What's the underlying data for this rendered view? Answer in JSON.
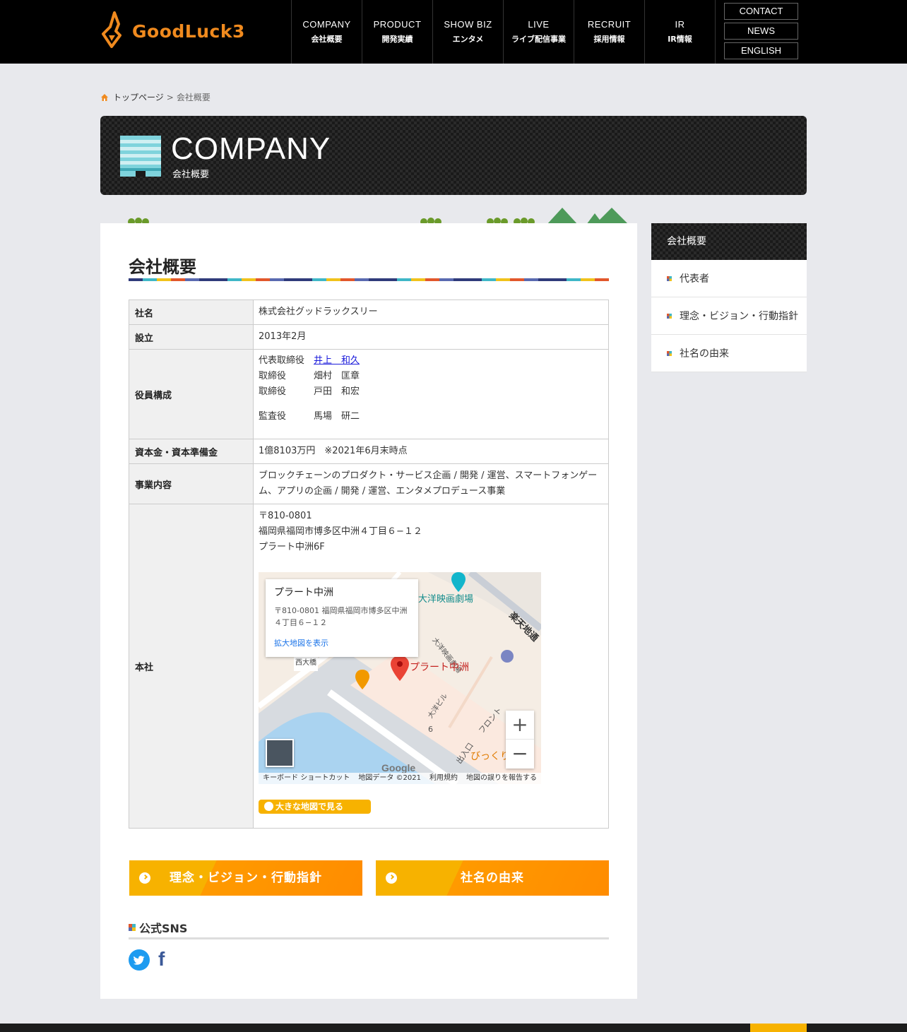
{
  "header": {
    "logo_text": "GoodLuck3",
    "nav": [
      {
        "en": "COMPANY",
        "ja": "会社概要"
      },
      {
        "en": "PRODUCT",
        "ja": "開発実績"
      },
      {
        "en": "SHOW BIZ",
        "ja": "エンタメ"
      },
      {
        "en": "LIVE",
        "ja": "ライブ配信事業"
      },
      {
        "en": "RECRUIT",
        "ja": "採用情報"
      },
      {
        "en": "IR",
        "ja": "IR情報"
      }
    ],
    "side_buttons": [
      "CONTACT",
      "NEWS",
      "ENGLISH"
    ]
  },
  "breadcrumb": {
    "home": "トップページ",
    "separator": ">",
    "current": "会社概要"
  },
  "banner": {
    "title": "COMPANY",
    "subtitle": "会社概要"
  },
  "main": {
    "section_title": "会社概要",
    "table": {
      "name_label": "社名",
      "name_value": "株式会社グッドラックスリー",
      "founded_label": "設立",
      "founded_value": "2013年2月",
      "officers_label": "役員構成",
      "officers": [
        {
          "role": "代表取締役",
          "name": "井上　和久"
        },
        {
          "role": "取締役",
          "name": "畑村　匡章"
        },
        {
          "role": "取締役",
          "name": "戸田　和宏"
        },
        {
          "role": "監査役",
          "name": "馬場　研二"
        }
      ],
      "capital_label": "資本金・資本準備金",
      "capital_value": "1億8103万円　※2021年6月末時点",
      "business_label": "事業内容",
      "business_value": "ブロックチェーンのプロダクト・サービス企画 / 開発 / 運営、スマートフォンゲーム、アプリの企画 / 開発 / 運営、エンタメプロデュース事業",
      "hq_label": "本社",
      "hq_postal": "〒810-0801",
      "hq_address": "福岡県福岡市博多区中洲４丁目６−１２",
      "hq_building": "プラート中洲6F"
    },
    "map": {
      "card_title": "プラート中洲",
      "card_address": "〒810-0801 福岡県福岡市博多区中洲４丁目６−１２",
      "card_link": "拡大地図を表示",
      "labels": {
        "theater": "大洋映画劇場",
        "theater_vertical": "大洋映画劇場",
        "place": "プラート中洲",
        "bridge": "西大橋",
        "street": "楽天地通",
        "building": "大洋ビル",
        "front": "フロント",
        "exit": "出入口",
        "surprise": "びっくり",
        "block": "6"
      },
      "google": "Google",
      "footer": [
        "キーボード ショートカット",
        "地図データ ©2021",
        "利用規約",
        "地図の誤りを報告する"
      ],
      "zoom_in": "+",
      "zoom_out": "−"
    },
    "bigmap_button": "大きな地図で見る",
    "buttons": [
      "理念・ビジョン・行動指針",
      "社名の由来"
    ],
    "sns_title": "公式SNS",
    "facebook_glyph": "f"
  },
  "sidebar": {
    "head": "会社概要",
    "items": [
      "代表者",
      "理念・ビジョン・行動指針",
      "社名の由来"
    ]
  }
}
